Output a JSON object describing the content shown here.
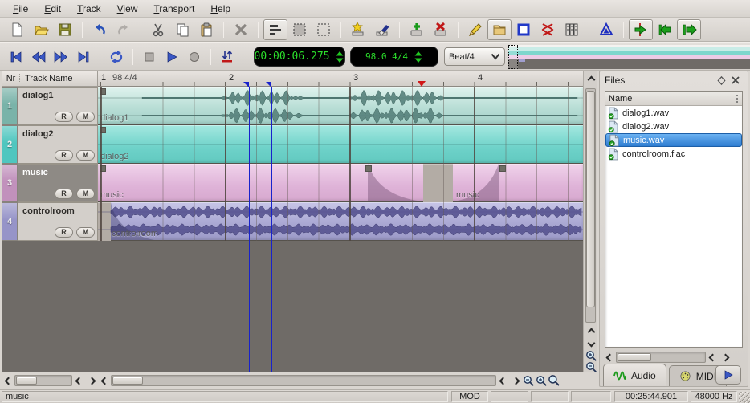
{
  "menu": {
    "items": [
      "File",
      "Edit",
      "Track",
      "View",
      "Transport",
      "Help"
    ]
  },
  "toolbar_row1": {
    "icons": [
      "new-file",
      "open-file",
      "save-file",
      "undo",
      "redo",
      "cut",
      "copy",
      "paste",
      "delete",
      "edit-mode",
      "region-select",
      "object-select",
      "new-sheet",
      "eraser",
      "add-track",
      "remove-track",
      "draw-pencil",
      "import-folder",
      "selection-box",
      "split-clip",
      "bus-grid",
      "metronome",
      "goto-playhead",
      "goto-start",
      "goto-end"
    ]
  },
  "transport": {
    "buttons": [
      "skip-to-start",
      "rewind",
      "fast-forward",
      "skip-to-end",
      "loop",
      "stop",
      "play",
      "record",
      "snap"
    ],
    "time_display": "00:00:06.275",
    "tempo_display": "98.0 4/4",
    "snap_combo": "Beat/4"
  },
  "ruler": {
    "bar1": "1",
    "tempo_sig": "98 4/4",
    "bars": [
      "2",
      "3",
      "4"
    ]
  },
  "track_panel": {
    "col_nr": "Nr",
    "col_name": "Track Name",
    "tracks": [
      {
        "nr": "1",
        "name": "dialog1",
        "rec_label": "R",
        "mute_label": "M",
        "color": "#79b3a9",
        "selected": false
      },
      {
        "nr": "2",
        "name": "dialog2",
        "rec_label": "R",
        "mute_label": "M",
        "color": "#4fc6bf",
        "selected": false
      },
      {
        "nr": "3",
        "name": "music",
        "rec_label": "R",
        "mute_label": "M",
        "color": "#c191bc",
        "selected": true
      },
      {
        "nr": "4",
        "name": "controlroom",
        "rec_label": "R",
        "mute_label": "M",
        "color": "#9694c8",
        "selected": false
      }
    ]
  },
  "timeline": {
    "clips": [
      {
        "track": "dialog1",
        "label": "dialog1"
      },
      {
        "track": "dialog2",
        "label": "dialog2"
      },
      {
        "track": "music",
        "label": "music"
      },
      {
        "track": "music",
        "label": "music"
      },
      {
        "track": "controlroom",
        "label": "controlroom"
      }
    ],
    "playhead_color": "#d01818",
    "marker_color": "#1822cc"
  },
  "files_panel": {
    "title": "Files",
    "column": "Name",
    "files": [
      {
        "name": "dialog1.wav",
        "selected": false
      },
      {
        "name": "dialog2.wav",
        "selected": false
      },
      {
        "name": "music.wav",
        "selected": true
      },
      {
        "name": "controlroom.flac",
        "selected": false
      }
    ],
    "tabs": [
      {
        "label": "Audio",
        "active": true
      },
      {
        "label": "MIDI",
        "active": false
      }
    ]
  },
  "statusbar": {
    "selection": "music",
    "cells": [
      "MOD",
      "",
      "",
      "",
      "00:25:44.901",
      "48000 Hz"
    ]
  },
  "colors": {
    "lcd_bg": "#000000",
    "lcd_text": "#2be02b",
    "selection_blue": "#3f8fdc",
    "lane_colors": [
      "#bfe3dc",
      "#7fd8d0",
      "#e3bcdd",
      "#b0aed8"
    ]
  }
}
